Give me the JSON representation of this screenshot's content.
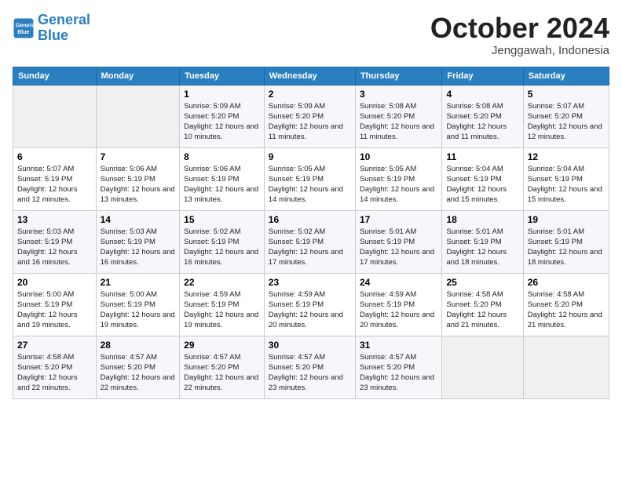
{
  "header": {
    "logo_line1": "General",
    "logo_line2": "Blue",
    "month": "October 2024",
    "location": "Jenggawah, Indonesia"
  },
  "weekdays": [
    "Sunday",
    "Monday",
    "Tuesday",
    "Wednesday",
    "Thursday",
    "Friday",
    "Saturday"
  ],
  "weeks": [
    [
      null,
      null,
      {
        "day": "1",
        "sunrise": "5:09 AM",
        "sunset": "5:20 PM",
        "daylight": "12 hours and 10 minutes."
      },
      {
        "day": "2",
        "sunrise": "5:09 AM",
        "sunset": "5:20 PM",
        "daylight": "12 hours and 11 minutes."
      },
      {
        "day": "3",
        "sunrise": "5:08 AM",
        "sunset": "5:20 PM",
        "daylight": "12 hours and 11 minutes."
      },
      {
        "day": "4",
        "sunrise": "5:08 AM",
        "sunset": "5:20 PM",
        "daylight": "12 hours and 11 minutes."
      },
      {
        "day": "5",
        "sunrise": "5:07 AM",
        "sunset": "5:20 PM",
        "daylight": "12 hours and 12 minutes."
      }
    ],
    [
      {
        "day": "6",
        "sunrise": "5:07 AM",
        "sunset": "5:19 PM",
        "daylight": "12 hours and 12 minutes."
      },
      {
        "day": "7",
        "sunrise": "5:06 AM",
        "sunset": "5:19 PM",
        "daylight": "12 hours and 13 minutes."
      },
      {
        "day": "8",
        "sunrise": "5:06 AM",
        "sunset": "5:19 PM",
        "daylight": "12 hours and 13 minutes."
      },
      {
        "day": "9",
        "sunrise": "5:05 AM",
        "sunset": "5:19 PM",
        "daylight": "12 hours and 14 minutes."
      },
      {
        "day": "10",
        "sunrise": "5:05 AM",
        "sunset": "5:19 PM",
        "daylight": "12 hours and 14 minutes."
      },
      {
        "day": "11",
        "sunrise": "5:04 AM",
        "sunset": "5:19 PM",
        "daylight": "12 hours and 15 minutes."
      },
      {
        "day": "12",
        "sunrise": "5:04 AM",
        "sunset": "5:19 PM",
        "daylight": "12 hours and 15 minutes."
      }
    ],
    [
      {
        "day": "13",
        "sunrise": "5:03 AM",
        "sunset": "5:19 PM",
        "daylight": "12 hours and 16 minutes."
      },
      {
        "day": "14",
        "sunrise": "5:03 AM",
        "sunset": "5:19 PM",
        "daylight": "12 hours and 16 minutes."
      },
      {
        "day": "15",
        "sunrise": "5:02 AM",
        "sunset": "5:19 PM",
        "daylight": "12 hours and 16 minutes."
      },
      {
        "day": "16",
        "sunrise": "5:02 AM",
        "sunset": "5:19 PM",
        "daylight": "12 hours and 17 minutes."
      },
      {
        "day": "17",
        "sunrise": "5:01 AM",
        "sunset": "5:19 PM",
        "daylight": "12 hours and 17 minutes."
      },
      {
        "day": "18",
        "sunrise": "5:01 AM",
        "sunset": "5:19 PM",
        "daylight": "12 hours and 18 minutes."
      },
      {
        "day": "19",
        "sunrise": "5:01 AM",
        "sunset": "5:19 PM",
        "daylight": "12 hours and 18 minutes."
      }
    ],
    [
      {
        "day": "20",
        "sunrise": "5:00 AM",
        "sunset": "5:19 PM",
        "daylight": "12 hours and 19 minutes."
      },
      {
        "day": "21",
        "sunrise": "5:00 AM",
        "sunset": "5:19 PM",
        "daylight": "12 hours and 19 minutes."
      },
      {
        "day": "22",
        "sunrise": "4:59 AM",
        "sunset": "5:19 PM",
        "daylight": "12 hours and 19 minutes."
      },
      {
        "day": "23",
        "sunrise": "4:59 AM",
        "sunset": "5:19 PM",
        "daylight": "12 hours and 20 minutes."
      },
      {
        "day": "24",
        "sunrise": "4:59 AM",
        "sunset": "5:19 PM",
        "daylight": "12 hours and 20 minutes."
      },
      {
        "day": "25",
        "sunrise": "4:58 AM",
        "sunset": "5:20 PM",
        "daylight": "12 hours and 21 minutes."
      },
      {
        "day": "26",
        "sunrise": "4:58 AM",
        "sunset": "5:20 PM",
        "daylight": "12 hours and 21 minutes."
      }
    ],
    [
      {
        "day": "27",
        "sunrise": "4:58 AM",
        "sunset": "5:20 PM",
        "daylight": "12 hours and 22 minutes."
      },
      {
        "day": "28",
        "sunrise": "4:57 AM",
        "sunset": "5:20 PM",
        "daylight": "12 hours and 22 minutes."
      },
      {
        "day": "29",
        "sunrise": "4:57 AM",
        "sunset": "5:20 PM",
        "daylight": "12 hours and 22 minutes."
      },
      {
        "day": "30",
        "sunrise": "4:57 AM",
        "sunset": "5:20 PM",
        "daylight": "12 hours and 23 minutes."
      },
      {
        "day": "31",
        "sunrise": "4:57 AM",
        "sunset": "5:20 PM",
        "daylight": "12 hours and 23 minutes."
      },
      null,
      null
    ]
  ],
  "labels": {
    "sunrise_label": "Sunrise:",
    "sunset_label": "Sunset:",
    "daylight_label": "Daylight: "
  }
}
